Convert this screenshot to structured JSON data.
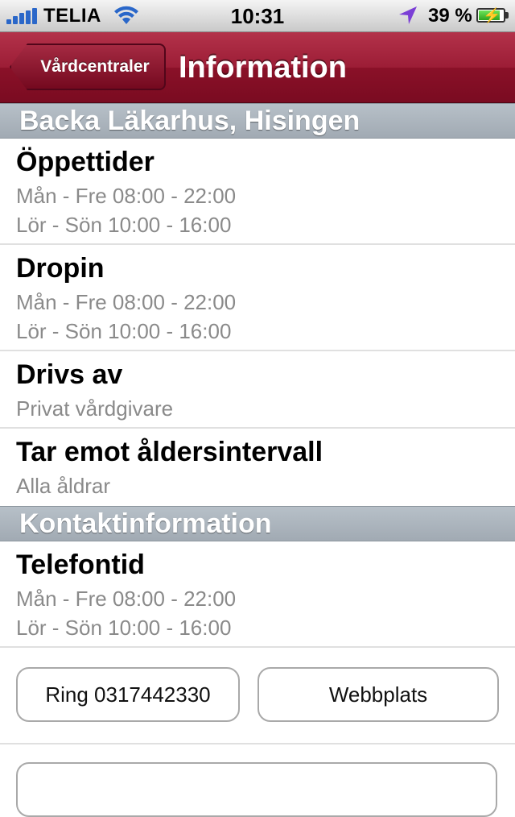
{
  "status_bar": {
    "carrier": "TELIA",
    "time": "10:31",
    "battery": "39 %",
    "battery_level_percent": 39,
    "icons": [
      "signal-bars-icon",
      "wifi-icon",
      "location-arrow-icon",
      "battery-charging-icon"
    ]
  },
  "nav": {
    "back_label": "Vårdcentraler",
    "title": "Information"
  },
  "clinic_section": {
    "header": "Backa Läkarhus, Hisingen"
  },
  "rows": {
    "opening": {
      "title": "Öppettider",
      "line1": "Mån - Fre 08:00 - 22:00",
      "line2": "Lör - Sön 10:00 - 16:00"
    },
    "dropin": {
      "title": "Dropin",
      "line1": "Mån - Fre 08:00 - 22:00",
      "line2": "Lör - Sön 10:00 - 16:00"
    },
    "operator": {
      "title": "Drivs av",
      "line1": "Privat vårdgivare"
    },
    "ages": {
      "title": "Tar emot åldersintervall",
      "line1": "Alla åldrar"
    }
  },
  "contact_section": {
    "header": "Kontaktinformation"
  },
  "phone_hours": {
    "title": "Telefontid",
    "line1": "Mån - Fre 08:00 - 22:00",
    "line2": "Lör - Sön 10:00 - 16:00"
  },
  "buttons": {
    "call": "Ring 0317442330",
    "website": "Webbplats"
  },
  "colors": {
    "nav_red": "#8a1128",
    "section_grey": "#a1aab3",
    "subtext": "#8a8a8a",
    "accent_blue": "#2a67c9"
  }
}
